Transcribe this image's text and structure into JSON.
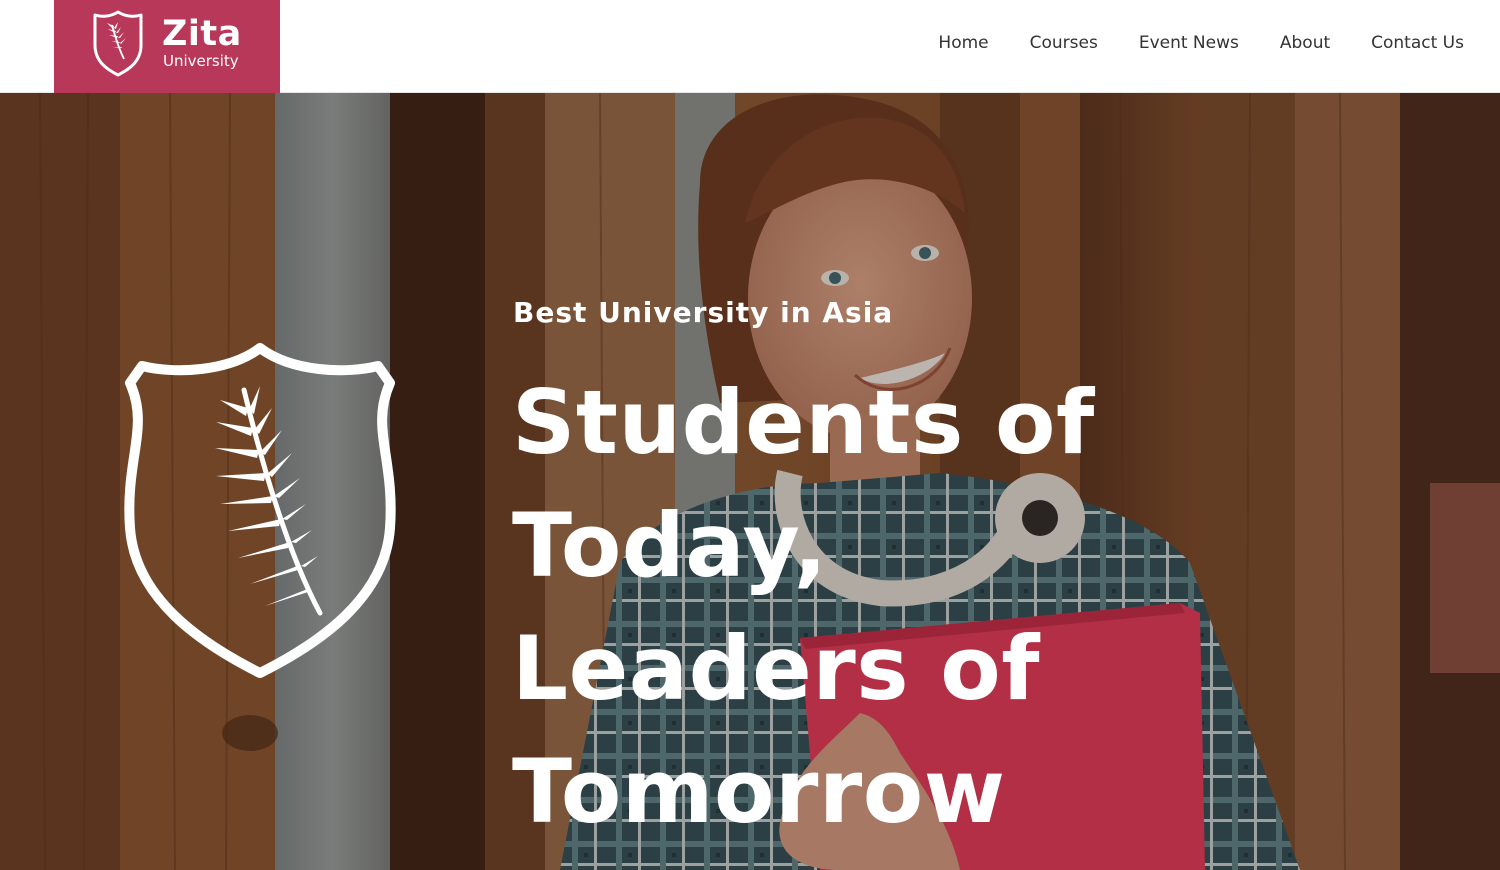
{
  "colors": {
    "brand": "#b8385a",
    "nav_text": "#333333",
    "hero_text": "#ffffff"
  },
  "header": {
    "logo": {
      "name": "Zita",
      "sub": "University",
      "icon": "shield-leaf-icon"
    },
    "nav": [
      {
        "label": "Home"
      },
      {
        "label": "Courses"
      },
      {
        "label": "Event News"
      },
      {
        "label": "About"
      },
      {
        "label": "Contact Us"
      }
    ]
  },
  "hero": {
    "kicker": "Best University in Asia",
    "title_lines": [
      "Students of Today,",
      "Leaders of",
      "Tomorrow"
    ],
    "emblem_icon": "shield-leaf-icon",
    "image": "student-holding-red-folder-photo"
  }
}
